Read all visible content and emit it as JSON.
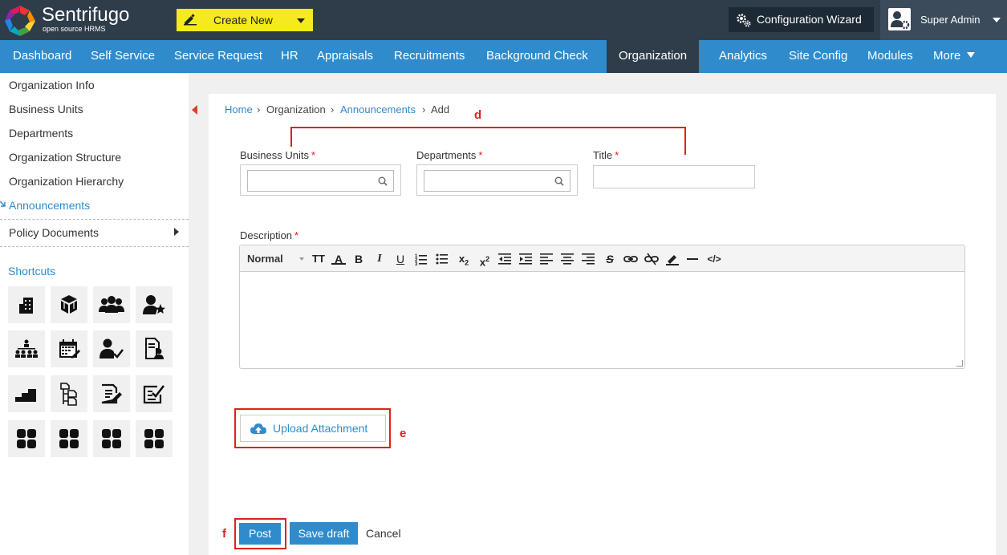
{
  "header": {
    "brand_name": "Sentrifugo",
    "brand_sub": "open source HRMS",
    "create_label": "Create New",
    "config_label": "Configuration Wizard",
    "user_label": "Super Admin"
  },
  "nav": {
    "items": [
      "Dashboard",
      "Self Service",
      "Service Request",
      "HR",
      "Appraisals",
      "Recruitments",
      "Background Check",
      "Organization",
      "Analytics",
      "Site Config",
      "Modules",
      "More"
    ],
    "active": "Organization"
  },
  "sidebar": {
    "links": [
      "Organization Info",
      "Business Units",
      "Departments",
      "Organization Structure",
      "Organization Hierarchy",
      "Announcements",
      "Policy Documents"
    ],
    "active": "Announcements",
    "shortcuts_title": "Shortcuts",
    "shortcut_icons": [
      "building-icon",
      "boxes-icon",
      "group-icon",
      "user-star-icon",
      "hierarchy-icon",
      "calendar-icon",
      "user-check-icon",
      "document-user-icon",
      "stairs-icon",
      "tree-docs-icon",
      "document-edit-icon",
      "checklist-icon",
      "grid-icon",
      "grid-icon",
      "grid-icon",
      "grid-icon"
    ]
  },
  "breadcrumb": {
    "home": "Home",
    "sep": "›",
    "organization": "Organization",
    "announcements": "Announcements",
    "current": "Add"
  },
  "form": {
    "business_units_label": "Business Units",
    "departments_label": "Departments",
    "title_label": "Title",
    "description_label": "Description",
    "required_mark": "*",
    "business_units_value": "",
    "departments_value": "",
    "title_value": ""
  },
  "editor": {
    "format": "Normal",
    "buttons": [
      "font-size",
      "font-color",
      "B",
      "I",
      "U",
      "ordered-list",
      "bullet-list",
      "subscript",
      "superscript",
      "outdent",
      "indent",
      "align-left",
      "align-center",
      "align-right",
      "strikethrough",
      "link",
      "unlink",
      "highlight",
      "horizontal-rule",
      "code"
    ]
  },
  "actions": {
    "upload_label": "Upload Attachment",
    "post_label": "Post",
    "draft_label": "Save draft",
    "cancel_label": "Cancel"
  },
  "annotations": {
    "d": "d",
    "e": "e",
    "f": "f"
  },
  "colors": {
    "topbar": "#2f3d4b",
    "nav": "#2f8bcc",
    "accent": "#2f8bcc",
    "create_button": "#f4ea1d",
    "annotation": "#e02020"
  }
}
